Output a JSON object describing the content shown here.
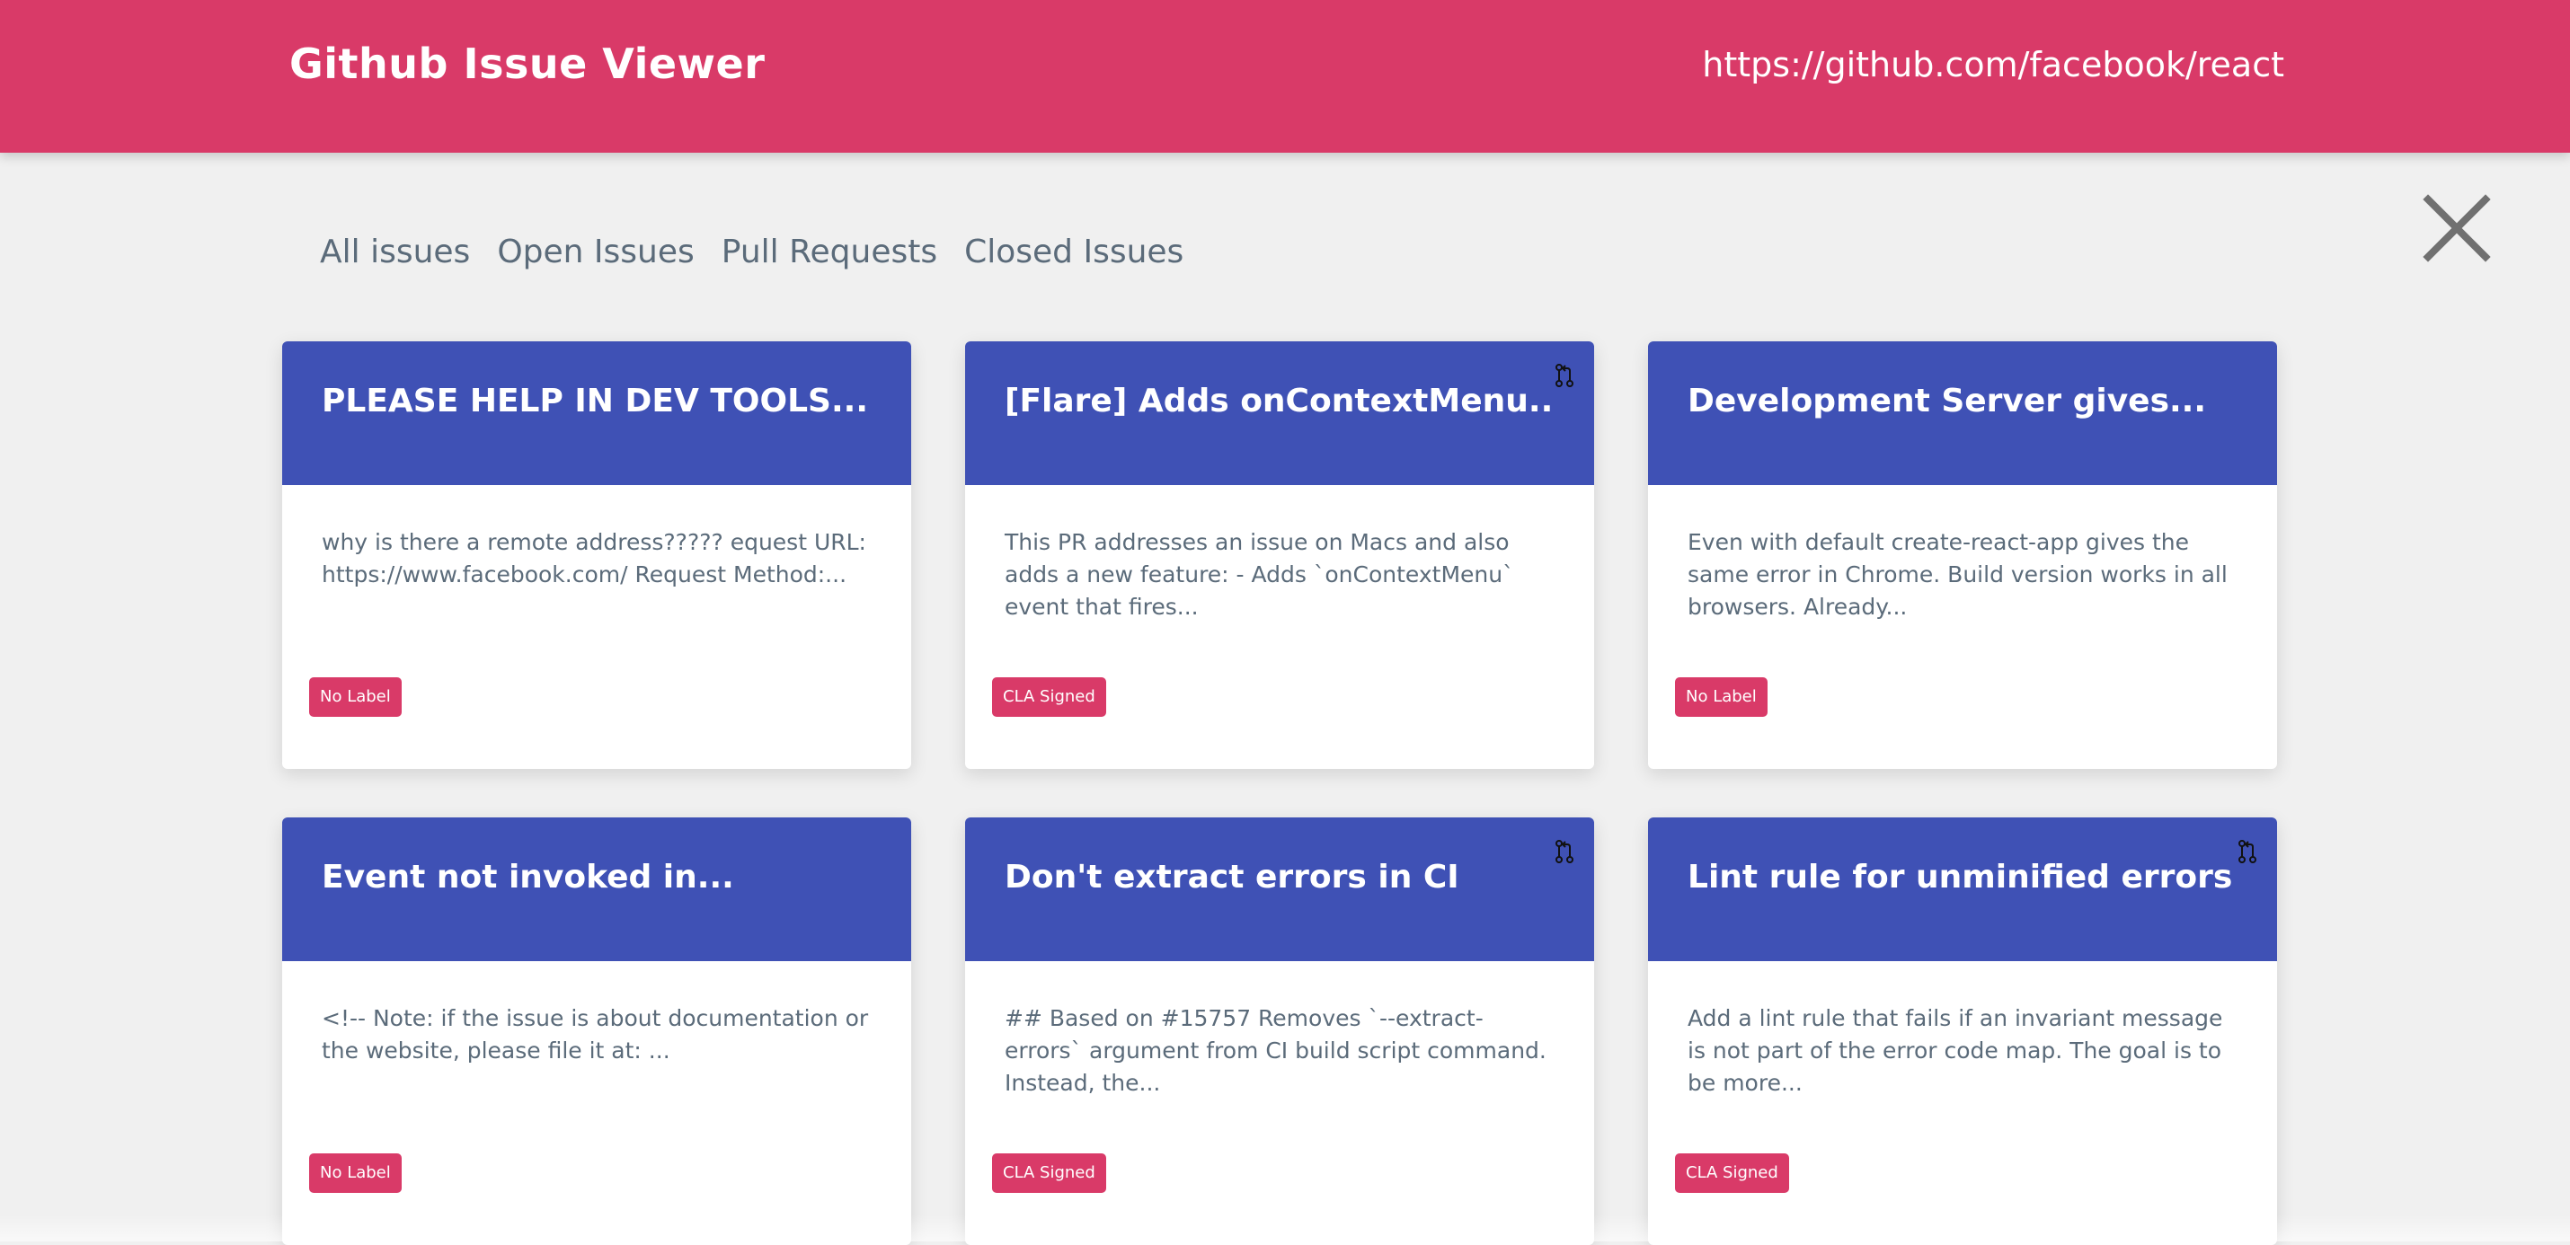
{
  "header": {
    "title": "Github Issue Viewer",
    "repo_url": "https://github.com/facebook/react"
  },
  "close_icon": "close-x-icon",
  "tabs": [
    {
      "label": "All issues"
    },
    {
      "label": "Open Issues"
    },
    {
      "label": "Pull Requests"
    },
    {
      "label": "Closed Issues"
    }
  ],
  "colors": {
    "header_bg": "#d93a68",
    "card_head_bg": "#3f51b5",
    "badge_bg": "#d93a68",
    "page_bg": "#f0f0f0"
  },
  "cards": [
    {
      "title": "PLEASE HELP IN DEV TOOLS...",
      "body": "why is there a remote address????? equest URL: https://www.facebook.com/ Request Method:...",
      "label": "No Label",
      "is_pull_request": false
    },
    {
      "title": "[Flare] Adds onContextMenu...",
      "body": "This PR addresses an issue on Macs and also adds a new feature:  - Adds `onContextMenu` event that fires...",
      "label": "CLA Signed",
      "is_pull_request": true
    },
    {
      "title": "Development Server gives...",
      "body": " Even with default create-react-app gives the same error in Chrome. Build version works in all browsers. Already...",
      "label": "No Label",
      "is_pull_request": false
    },
    {
      "title": "Event not invoked in...",
      "body": "<!-- Note: if the issue is about documentation or the website, please file it at: ...",
      "label": "No Label",
      "is_pull_request": false
    },
    {
      "title": "Don't extract errors in CI",
      "body": "## Based on #15757   Removes `--extract-errors` argument from CI build script command. Instead, the...",
      "label": "CLA Signed",
      "is_pull_request": true
    },
    {
      "title": "Lint rule for unminified errors",
      "body": "Add a lint rule that fails if an invariant message is not part of the error code map.  The goal is to be more...",
      "label": "CLA Signed",
      "is_pull_request": true
    }
  ]
}
